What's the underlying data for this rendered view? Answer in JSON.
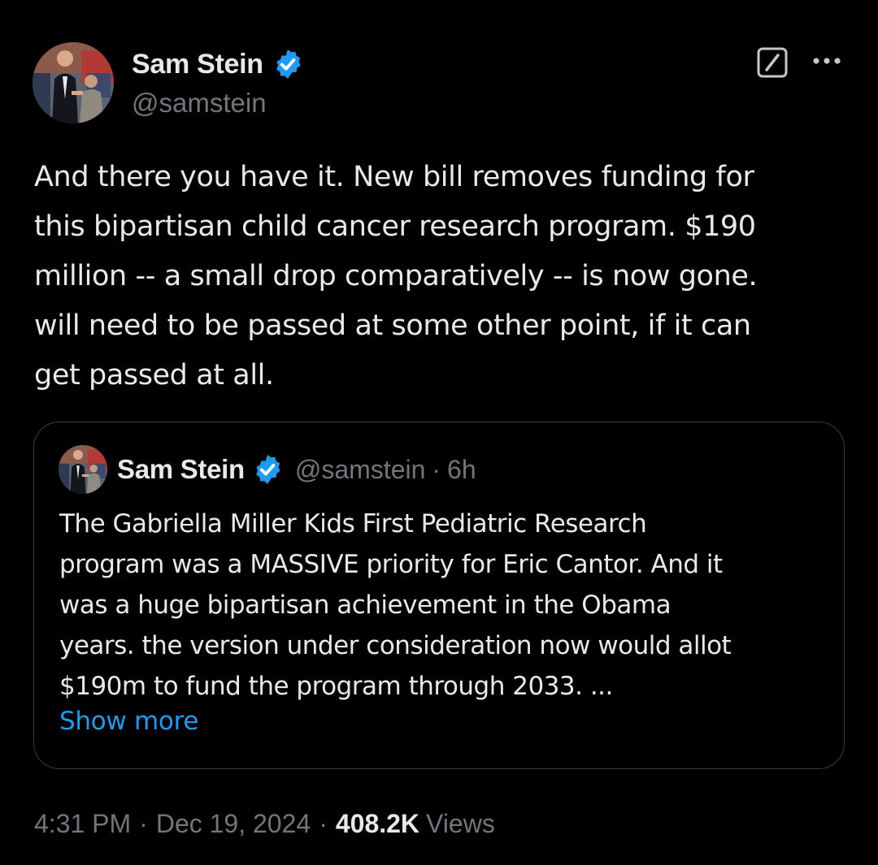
{
  "author": {
    "display_name": "Sam Stein",
    "handle": "@samstein",
    "verified": true,
    "verified_color": "#1d9bf0"
  },
  "header_icons": {
    "grok": "grok-icon",
    "more": "more-icon"
  },
  "tweet": {
    "text": "And there you have it. New bill removes funding for\nthis bipartisan child cancer research program. $190\nmillion -- a small drop comparatively -- is now gone.\nwill need to be passed at some other point, if it can\nget passed at all."
  },
  "quote": {
    "display_name": "Sam Stein",
    "handle": "@samstein",
    "dot": "·",
    "time": "6h",
    "text": "The Gabriella Miller Kids First Pediatric Research\nprogram was a MASSIVE priority for Eric Cantor. And it\nwas a huge bipartisan achievement in the Obama\nyears. the version under consideration now would allot\n$190m to fund the program through 2033. ...",
    "show_more": "Show more"
  },
  "meta": {
    "time": "4:31 PM",
    "sep1": "·",
    "date": "Dec 19, 2024",
    "sep2": "·",
    "views_count": "408.2K",
    "views_label": "Views"
  },
  "colors": {
    "background": "#000000",
    "text_primary": "#e7e9ea",
    "text_secondary": "#71767b",
    "link": "#1d9bf0",
    "border": "#3a3d41"
  }
}
